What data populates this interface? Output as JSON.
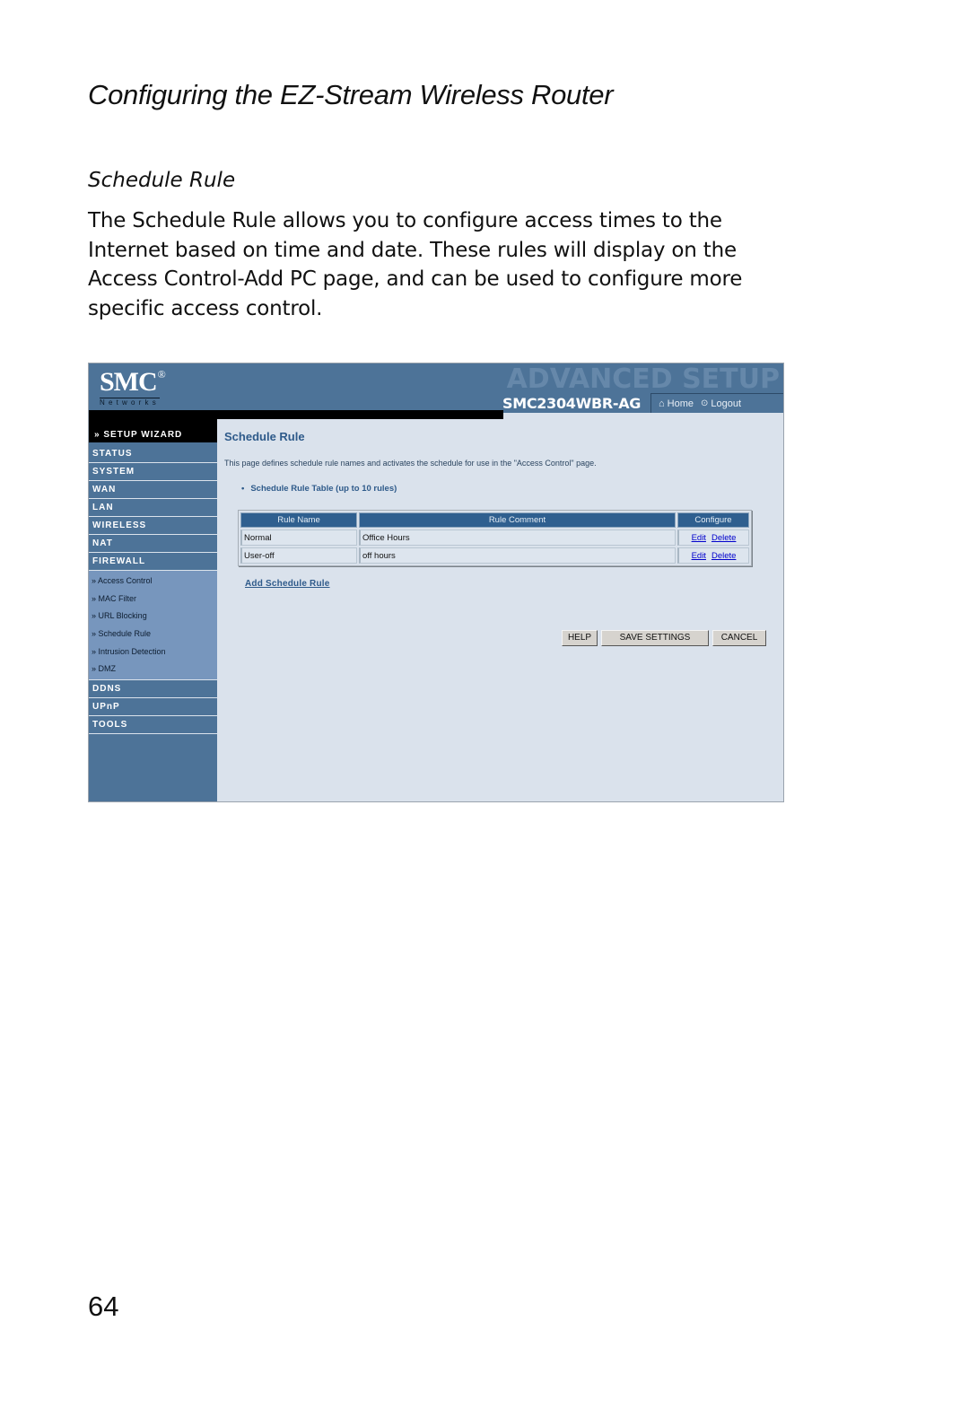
{
  "document": {
    "header": "Configuring the EZ-Stream Wireless Router",
    "section_title": "Schedule Rule",
    "body_text": "The Schedule Rule allows you to configure access times to the Internet based on time and date. These rules will display on the Access Control-Add PC page, and can be used to configure more specific access control.",
    "page_number": "64"
  },
  "router_ui": {
    "brand": {
      "logo": "SMC",
      "logo_mark": "®",
      "logo_sub": "Networks",
      "banner": "ADVANCED SETUP",
      "model": "SMC2304WBR-AG"
    },
    "top_nav": {
      "home": {
        "label": "Home",
        "icon": "home-icon"
      },
      "logout": {
        "label": "Logout",
        "icon": "logout-icon"
      }
    },
    "sidebar": {
      "setup_wizard": "» SETUP WIZARD",
      "items_top": [
        "STATUS",
        "SYSTEM",
        "WAN",
        "LAN",
        "WIRELESS",
        "NAT",
        "FIREWALL"
      ],
      "firewall_sub": [
        "» Access Control",
        "» MAC Filter",
        "» URL Blocking",
        "» Schedule Rule",
        "» Intrusion Detection",
        "» DMZ"
      ],
      "items_bottom": [
        "DDNS",
        "UPnP",
        "TOOLS"
      ]
    },
    "content": {
      "title": "Schedule Rule",
      "description": "This page defines schedule rule names and activates the schedule for use in the \"Access Control\" page.",
      "bullet": "Schedule Rule Table (up to 10 rules)",
      "table": {
        "headers": [
          "Rule Name",
          "Rule Comment",
          "Configure"
        ],
        "rows": [
          {
            "name": "Normal",
            "comment": "Office Hours",
            "edit": "Edit",
            "delete": "Delete"
          },
          {
            "name": "User-off",
            "comment": "off hours",
            "edit": "Edit",
            "delete": "Delete"
          }
        ]
      },
      "add_link": "Add Schedule Rule",
      "buttons": {
        "help": "HELP",
        "save": "SAVE SETTINGS",
        "cancel": "CANCEL"
      }
    },
    "colors": {
      "header_blue": "#4d7398",
      "content_bg": "#dae2ec",
      "table_header": "#2f5f8f",
      "sub_menu": "#7796bd",
      "link": "#0000cc"
    }
  }
}
